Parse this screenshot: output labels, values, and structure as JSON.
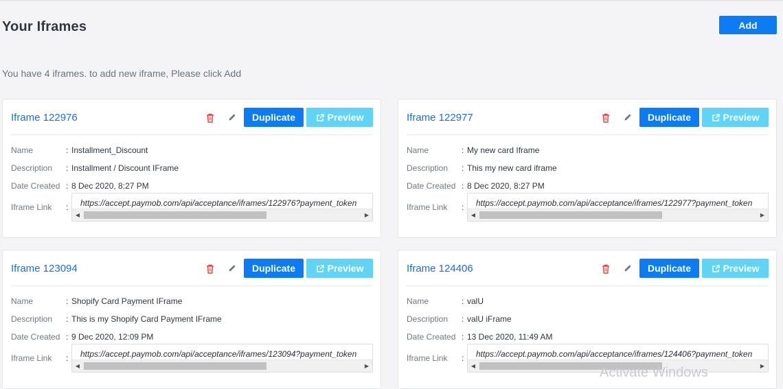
{
  "header": {
    "title": "Your Iframes",
    "add_label": "Add",
    "subtitle": "You have 4 iframes. to add new iframe, Please click Add"
  },
  "labels": {
    "name": "Name",
    "description": "Description",
    "date_created": "Date Created",
    "iframe_link": "Iframe Link",
    "colon": ":",
    "duplicate": "Duplicate",
    "preview": "Preview"
  },
  "iframes": [
    {
      "title": "Iframe 122976",
      "name": "Installment_Discount",
      "description": "Installment / Discount IFrame",
      "date_created": "8 Dec 2020, 8:27 PM",
      "link": "https://accept.paymob.com/api/acceptance/iframes/122976?payment_token"
    },
    {
      "title": "Iframe 122977",
      "name": "My new card Iframe",
      "description": "This my new card iframe",
      "date_created": "8 Dec 2020, 8:27 PM",
      "link": "https://accept.paymob.com/api/acceptance/iframes/122977?payment_token"
    },
    {
      "title": "Iframe 123094",
      "name": "Shopify Card Payment IFrame",
      "description": "This is my Shopify Card Payment IFrame",
      "date_created": "9 Dec 2020, 12:09 PM",
      "link": "https://accept.paymob.com/api/acceptance/iframes/123094?payment_token"
    },
    {
      "title": "Iframe 124406",
      "name": "valU",
      "description": "valU iFrame",
      "date_created": "13 Dec 2020, 11:49 AM",
      "link": "https://accept.paymob.com/api/acceptance/iframes/124406?payment_token"
    }
  ],
  "watermark": "Activate Windows",
  "colors": {
    "primary": "#0d7bf1",
    "preview": "#61d3f4",
    "delete": "#e0443c",
    "title_link": "#1a6fd8"
  },
  "icons": {
    "delete": "trash-icon",
    "edit": "pencil-icon",
    "preview": "external-link-icon",
    "scroll_left": "chevron-left-icon",
    "scroll_right": "chevron-right-icon"
  }
}
